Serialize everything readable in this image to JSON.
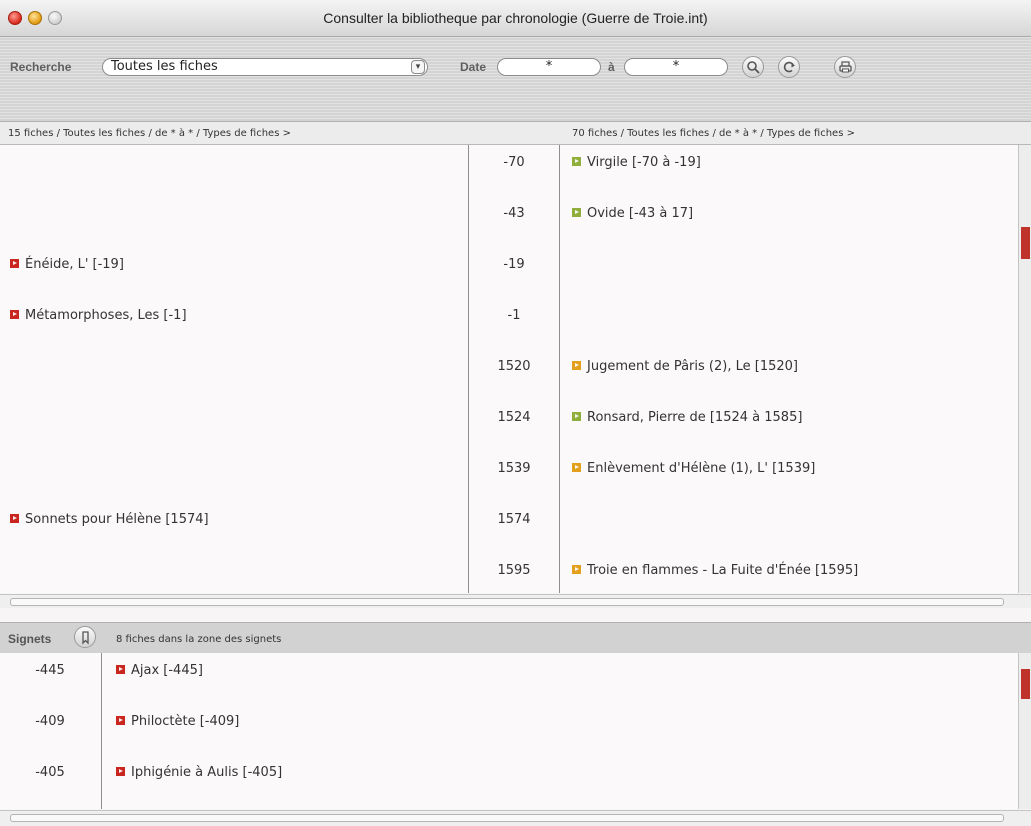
{
  "window": {
    "title": "Consulter la bibliotheque par chronologie (Guerre de Troie.int)"
  },
  "toolbar": {
    "search_label": "Recherche",
    "search_value": "Toutes les fiches",
    "date_label": "Date",
    "date_from": "*",
    "date_sep": "à",
    "date_to": "*"
  },
  "info": {
    "left": "15 fiches / Toutes les fiches / de * à * / Types de fiches >",
    "right": "70 fiches / Toutes les fiches / de * à * / Types de fiches >"
  },
  "timeline": [
    {
      "left": "",
      "year": "-70",
      "right": "Virgile [-70 à -19]",
      "right_color": "green"
    },
    {
      "left": "",
      "year": "-43",
      "right": "Ovide [-43 à 17]",
      "right_color": "green"
    },
    {
      "left": "Énéide, L' [-19]",
      "year": "-19",
      "right": "",
      "right_color": ""
    },
    {
      "left": "Métamorphoses, Les [-1]",
      "year": "-1",
      "right": "",
      "right_color": ""
    },
    {
      "left": "",
      "year": "1520",
      "right": "Jugement de Pâris (2), Le [1520]",
      "right_color": "orange"
    },
    {
      "left": "",
      "year": "1524",
      "right": "Ronsard, Pierre de [1524 à 1585]",
      "right_color": "green"
    },
    {
      "left": "",
      "year": "1539",
      "right": "Enlèvement d'Hélène (1), L' [1539]",
      "right_color": "orange"
    },
    {
      "left": "Sonnets pour Hélène [1574]",
      "year": "1574",
      "right": "",
      "right_color": ""
    },
    {
      "left": "",
      "year": "1595",
      "right": "Troie en flammes - La Fuite d'Énée [1595]",
      "right_color": "orange"
    }
  ],
  "bookmarks": {
    "label": "Signets",
    "count_text": "8 fiches dans la zone des signets",
    "items": [
      {
        "year": "-445",
        "title": "Ajax [-445]"
      },
      {
        "year": "-409",
        "title": "Philoctète [-409]"
      },
      {
        "year": "-405",
        "title": "Iphigénie à Aulis [-405]"
      }
    ]
  },
  "colors": {
    "red": "#c8261e",
    "green": "#8fae3c",
    "orange": "#e3a01d",
    "thumb": "#c0332b"
  },
  "icons": [
    "search-icon",
    "refresh-icon",
    "print-icon",
    "bookmark-icon"
  ]
}
